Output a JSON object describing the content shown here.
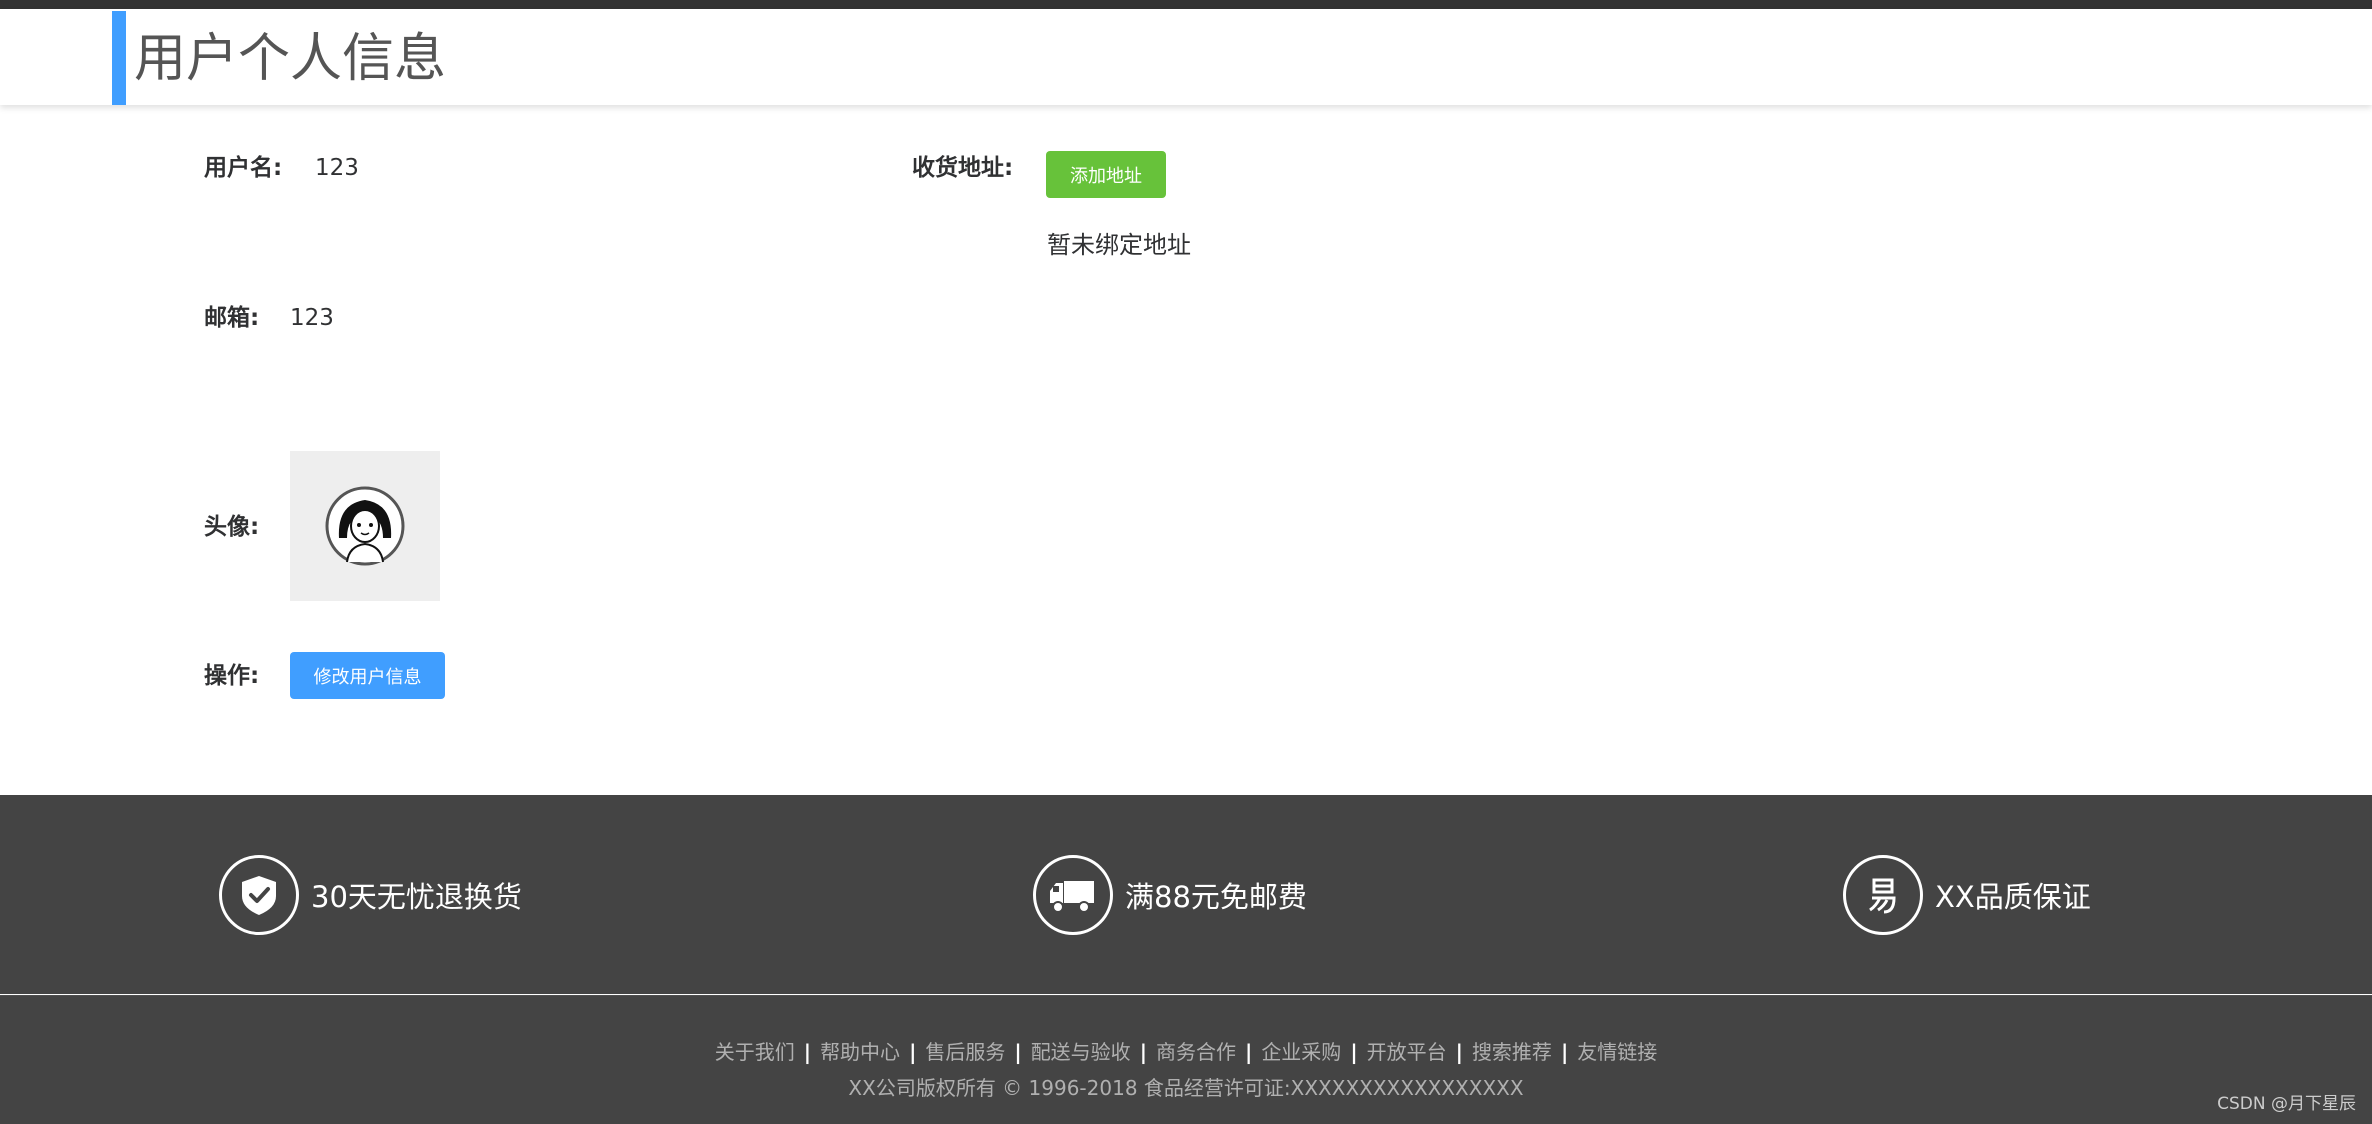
{
  "header": {
    "title": "用户个人信息"
  },
  "profile": {
    "username_label": "用户名:",
    "username_value": "123",
    "email_label": "邮箱:",
    "email_value": "123",
    "avatar_label": "头像:",
    "action_label": "操作:",
    "edit_button": "修改用户信息"
  },
  "address": {
    "label": "收货地址:",
    "add_button": "添加地址",
    "empty_text": "暂未绑定地址"
  },
  "promises": [
    {
      "icon": "shield-check-icon",
      "text": "30天无忧退换货"
    },
    {
      "icon": "truck-icon",
      "text": "满88元免邮费"
    },
    {
      "icon": "yi-logo-icon",
      "text": "XX品质保证"
    }
  ],
  "footer": {
    "links": [
      "关于我们",
      "帮助中心",
      "售后服务",
      "配送与验收",
      "商务合作",
      "企业采购",
      "开放平台",
      "搜索推荐",
      "友情链接"
    ],
    "copyright": "XX公司版权所有 © 1996-2018 食品经营许可证:XXXXXXXXXXXXXXXXX"
  },
  "watermark": "CSDN @月下星辰",
  "colors": {
    "accent": "#409eff",
    "success": "#67c23a",
    "footer_bg": "#444444",
    "topbar": "#333333"
  }
}
